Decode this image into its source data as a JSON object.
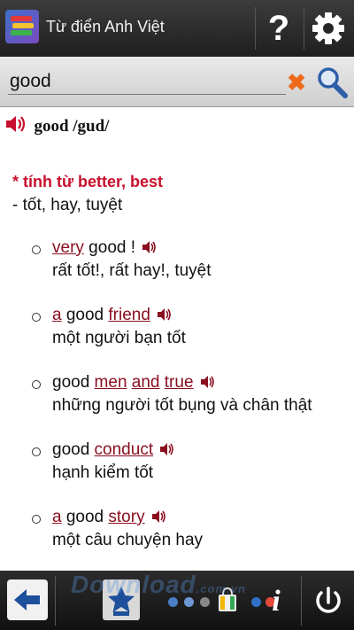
{
  "app": {
    "title": "Từ điển Anh Việt"
  },
  "topbar": {
    "help_icon": "question-icon",
    "settings_icon": "gear-icon"
  },
  "search": {
    "value": "good",
    "clear_icon": "close-icon",
    "search_icon": "search-icon"
  },
  "entry": {
    "headword": "good /gud/",
    "pos": "* tính từ better, best",
    "meaning": "- tốt, hay, tuyệt",
    "examples": [
      {
        "en": [
          "very",
          " good !"
        ],
        "vi": "rất tốt!, rất hay!, tuyệt"
      },
      {
        "en": [
          "a",
          " good ",
          "friend"
        ],
        "vi": "một người bạn tốt"
      },
      {
        "en": [
          "good ",
          "men",
          " ",
          "and",
          " ",
          "true"
        ],
        "vi": "những người tốt bụng và chân thật"
      },
      {
        "en": [
          "good ",
          "conduct"
        ],
        "vi": "hạnh kiểm tốt"
      },
      {
        "en": [
          "a",
          " good ",
          "story"
        ],
        "vi": "một câu chuyện hay"
      }
    ]
  },
  "colors": {
    "accent_red": "#c8102e",
    "link": "#8a1020",
    "clear_orange": "#ef6a1c"
  },
  "watermark": {
    "text": "Download",
    "suffix": ".com.vn"
  }
}
